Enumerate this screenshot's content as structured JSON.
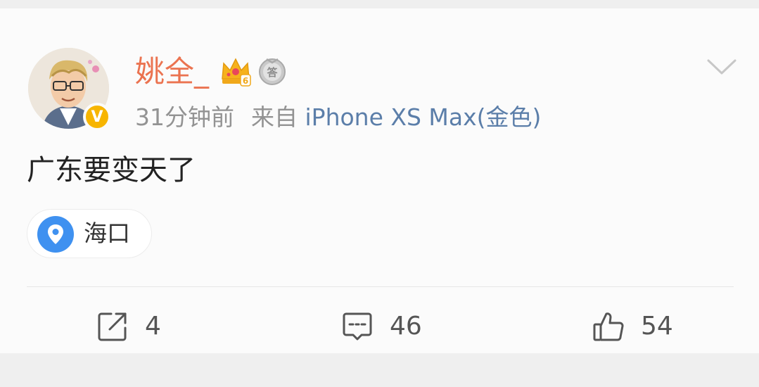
{
  "post": {
    "username": "姚全_",
    "timestamp": "31分钟前",
    "source_prefix": "来自",
    "source_device": "iPhone XS Max(金色)",
    "text": "广东要变天了",
    "location": "海口",
    "icons": {
      "avatar": "avatar-cartoon",
      "verified": "verified-v-badge",
      "crown": "crown-level-icon",
      "medal": "medal-icon",
      "more": "chevron-down-icon",
      "location": "location-pin-icon"
    },
    "verified_label": "V",
    "crown_level": "6",
    "medal_label": "答"
  },
  "actions": {
    "repost_count": "4",
    "comment_count": "46",
    "like_count": "54"
  },
  "colors": {
    "username": "#eb7350",
    "source": "#5b7ea9",
    "meta": "#939393",
    "verified": "#f7b500",
    "location_pin": "#3f91f0"
  }
}
